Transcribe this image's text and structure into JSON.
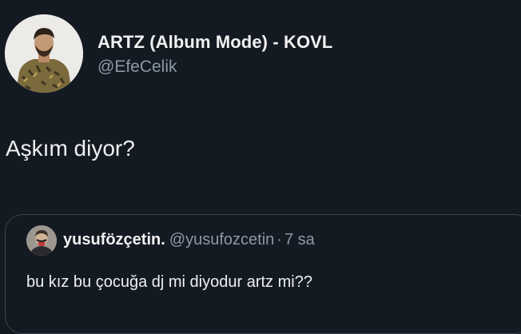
{
  "tweet": {
    "author_name": "ARTZ (Album Mode) - KOVL",
    "author_handle": "@EfeCelik",
    "text": "Aşkım diyor?"
  },
  "quote": {
    "author_name": "yusufözçetin.",
    "author_handle": "@yusufozcetin",
    "separator": "·",
    "time": "7 sa",
    "text": "bu kız bu çocuğa dj mi diyodur artz mi??"
  },
  "colors": {
    "background": "#141a22",
    "primary_text": "#eef0f1",
    "secondary_text": "#8b98a5",
    "card_border": "#38444d"
  }
}
